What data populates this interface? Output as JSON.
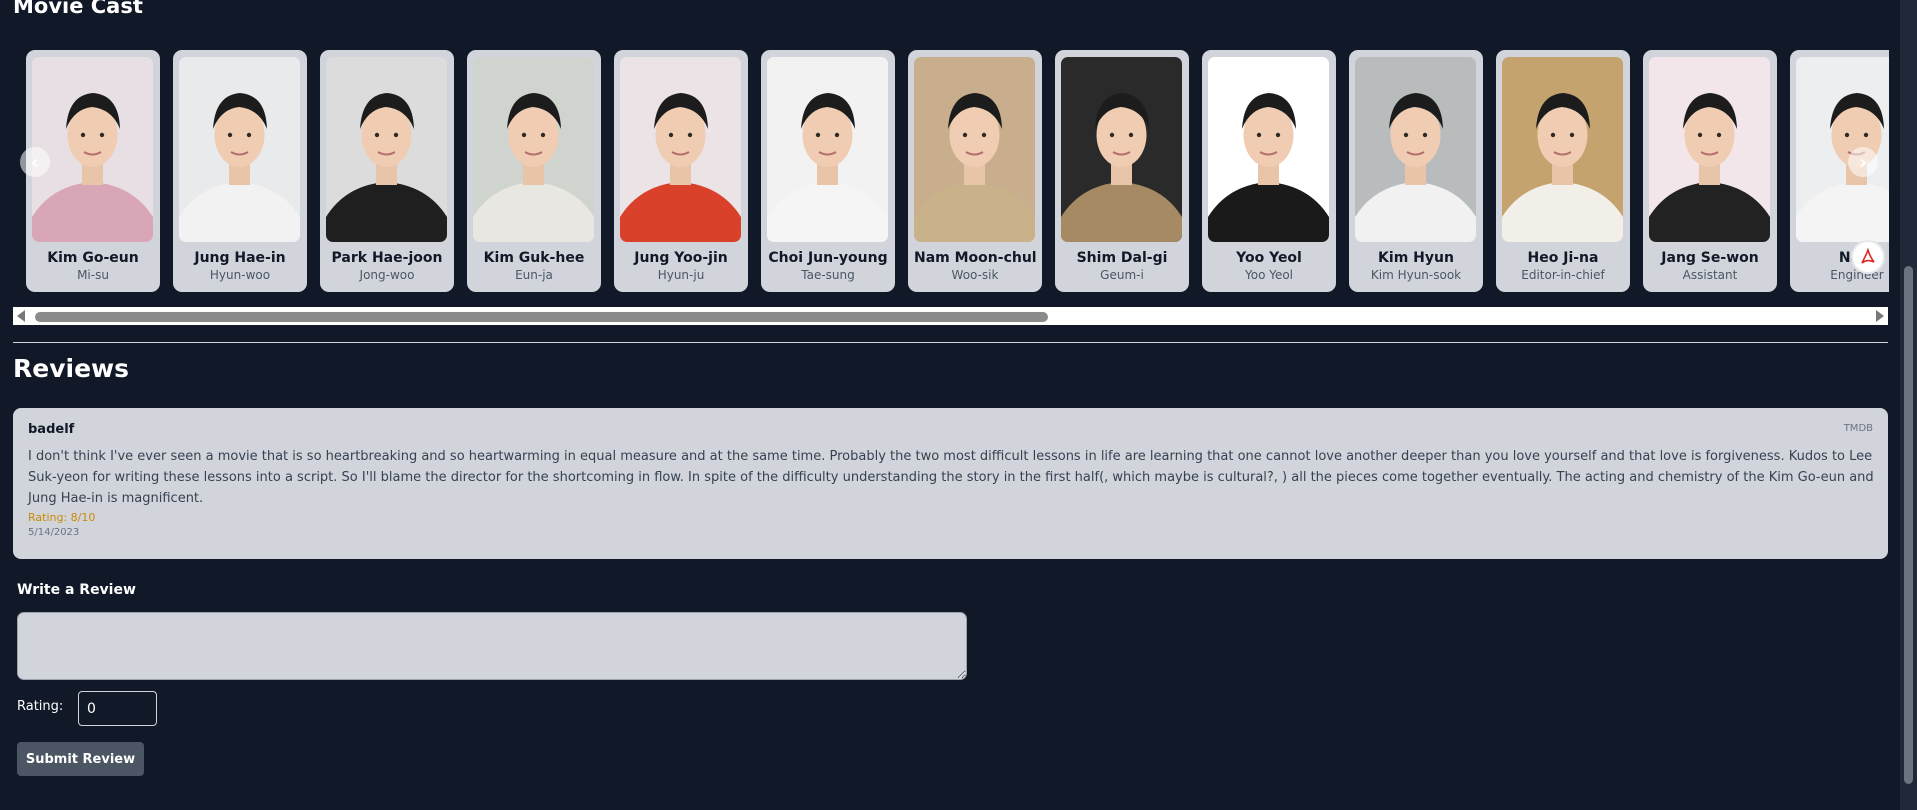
{
  "cast_section": {
    "title": "Movie Cast",
    "members": [
      {
        "name": "Kim Go-eun",
        "role": "Mi-su",
        "tone": "#d9a6b8",
        "bg": "#e8dfe4"
      },
      {
        "name": "Jung Hae-in",
        "role": "Hyun-woo",
        "tone": "#f2f2f2",
        "bg": "#e9eaec"
      },
      {
        "name": "Park Hae-joon",
        "role": "Jong-woo",
        "tone": "#1f1f1f",
        "bg": "#dcdcdc"
      },
      {
        "name": "Kim Guk-hee",
        "role": "Eun-ja",
        "tone": "#e9e7e2",
        "bg": "#cfd4cf"
      },
      {
        "name": "Jung Yoo-jin",
        "role": "Hyun-ju",
        "tone": "#d9412b",
        "bg": "#ece3e6"
      },
      {
        "name": "Choi Jun-young",
        "role": "Tae-sung",
        "tone": "#f5f5f5",
        "bg": "#f2f2f2"
      },
      {
        "name": "Nam Moon-chul",
        "role": "Woo-sik",
        "tone": "#c9b28a",
        "bg": "#c8ae8c"
      },
      {
        "name": "Shim Dal-gi",
        "role": "Geum-i",
        "tone": "#a58a63",
        "bg": "#2a2a2a"
      },
      {
        "name": "Yoo Yeol",
        "role": "Yoo Yeol",
        "tone": "#1a1a1a",
        "bg": "#ffffff"
      },
      {
        "name": "Kim Hyun",
        "role": "Kim Hyun-sook",
        "tone": "#f1f1f1",
        "bg": "#b9bcbc"
      },
      {
        "name": "Heo Ji-na",
        "role": "Editor-in-chief",
        "tone": "#f2efe9",
        "bg": "#c5a36e"
      },
      {
        "name": "Jang Se-won",
        "role": "Assistant",
        "tone": "#222222",
        "bg": "#f3e6ea"
      },
      {
        "name": "Na C",
        "role": "Engineer",
        "tone": "#f4f4f4",
        "bg": "#eceef0"
      }
    ],
    "prev_arrow": "‹",
    "next_arrow": "›",
    "icons": {
      "prev": "chevron-left-icon",
      "next": "chevron-right-icon",
      "floating": "pdf-icon"
    }
  },
  "reviews_section": {
    "title": "Reviews",
    "reviews": [
      {
        "author": "badelf",
        "source": "TMDB",
        "text": "I don't think I've ever seen a movie that is so heartbreaking and so heartwarming in equal measure and at the same time. Probably the two most difficult lessons in life are learning that one cannot love another deeper than you love yourself and that love is forgiveness. Kudos to Lee Suk-yeon for writing these lessons into a script. So I'll blame the director for the shortcoming in flow. In spite of the difficulty understanding the story in the first half(, which maybe is cultural?, ) all the pieces come together eventually. The acting and chemistry of the Kim Go-eun and Jung Hae-in is magnificent.",
        "rating": "Rating: 8/10",
        "date": "5/14/2023"
      }
    ]
  },
  "write_review": {
    "label": "Write a Review",
    "textarea_value": "",
    "rating_label": "Rating:",
    "rating_value": "0",
    "submit_label": "Submit Review"
  },
  "colors": {
    "background": "#111827",
    "card": "#d1d5db",
    "rating_accent": "#ca8a04",
    "button": "#4b5563"
  }
}
